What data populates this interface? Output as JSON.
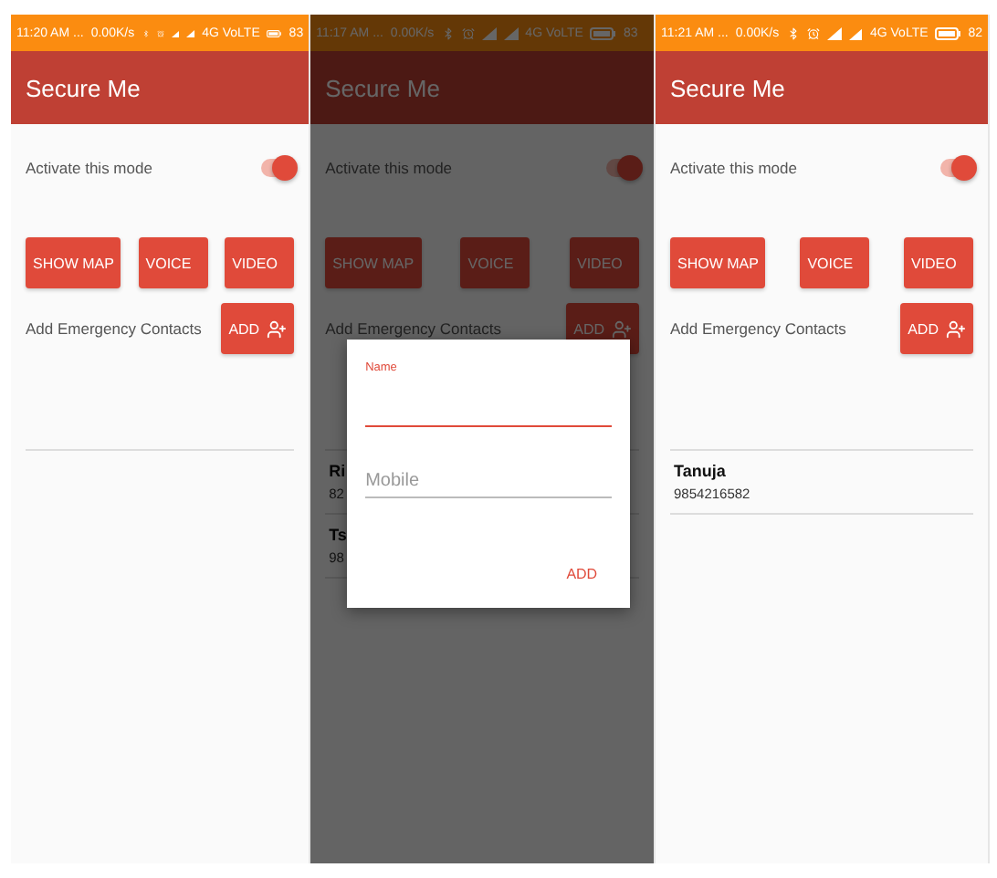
{
  "screens": [
    {
      "status_bar": {
        "time": "11:20 AM ...",
        "speed": "0.00K/s",
        "network": "4G VoLTE",
        "battery": "83"
      },
      "app_bar": {
        "title": "Secure Me"
      },
      "mode": {
        "label": "Activate this mode",
        "on": true
      },
      "actions": [
        "SHOW MAP",
        "VOICE",
        "VIDEO"
      ],
      "contacts_section": {
        "label": "Add Emergency Contacts",
        "button": "ADD"
      },
      "dimmed": false
    },
    {
      "status_bar": {
        "time": "11:17 AM ...",
        "speed": "0.00K/s",
        "network": "4G VoLTE",
        "battery": "83"
      },
      "app_bar": {
        "title": "Secure Me"
      },
      "mode": {
        "label": "Activate this mode",
        "on": true
      },
      "actions": [
        "SHOW MAP",
        "VOICE",
        "VIDEO"
      ],
      "contacts_section": {
        "label": "Add Emergency Contacts",
        "button": "ADD"
      },
      "contacts": [
        {
          "name": "Ri",
          "phone": "82"
        },
        {
          "name": "Ts",
          "phone": "98"
        }
      ],
      "dimmed": true,
      "dialog": {
        "fields": [
          {
            "label": "Name",
            "focused": true
          },
          {
            "placeholder": "Mobile",
            "focused": false
          }
        ],
        "button": "ADD"
      }
    },
    {
      "status_bar": {
        "time": "11:21 AM ...",
        "speed": "0.00K/s",
        "network": "4G VoLTE",
        "battery": "82"
      },
      "app_bar": {
        "title": "Secure Me"
      },
      "mode": {
        "label": "Activate this mode",
        "on": true
      },
      "actions": [
        "SHOW MAP",
        "VOICE",
        "VIDEO"
      ],
      "contacts_section": {
        "label": "Add Emergency Contacts",
        "button": "ADD"
      },
      "contacts": [
        {
          "name": "Tanuja",
          "phone": "9854216582"
        }
      ],
      "dimmed": false
    }
  ]
}
